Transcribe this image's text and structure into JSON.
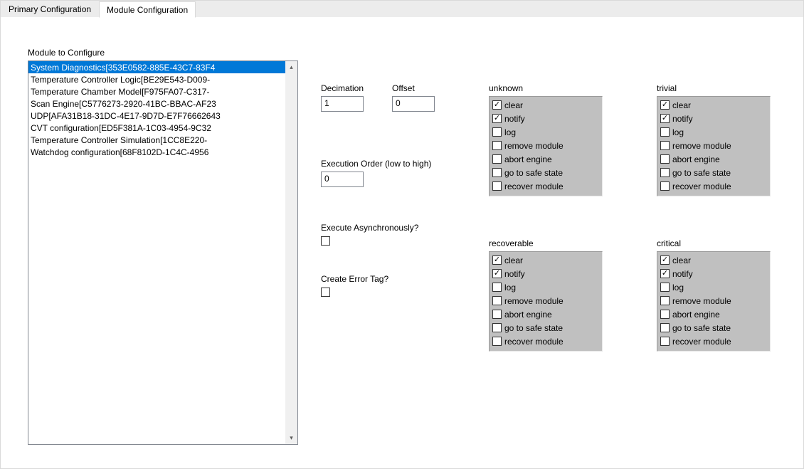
{
  "tabs": {
    "primary": "Primary Configuration",
    "module": "Module Configuration"
  },
  "module_list": {
    "label": "Module to Configure",
    "selected_index": 0,
    "items": [
      "System Diagnostics[353E0582-885E-43C7-83F4",
      "Temperature Controller Logic[BE29E543-D009-",
      "Temperature Chamber Model[F975FA07-C317-",
      "Scan Engine[C5776273-2920-41BC-BBAC-AF23",
      "UDP[AFA31B18-31DC-4E17-9D7D-E7F76662643",
      "CVT configuration[ED5F381A-1C03-4954-9C32",
      "Temperature Controller Simulation[1CC8E220-",
      "Watchdog configuration[68F8102D-1C4C-4956"
    ]
  },
  "fields": {
    "decimation_label": "Decimation",
    "decimation_value": "1",
    "offset_label": "Offset",
    "offset_value": "0",
    "exec_order_label": "Execution Order (low to high)",
    "exec_order_value": "0",
    "async_label": "Execute Asynchronously?",
    "async_checked": false,
    "errtag_label": "Create Error Tag?",
    "errtag_checked": false
  },
  "option_labels": [
    "clear",
    "notify",
    "log",
    "remove module",
    "abort engine",
    "go to safe state",
    "recover module"
  ],
  "groups": {
    "unknown": {
      "title": "unknown",
      "checked": [
        true,
        true,
        false,
        false,
        false,
        false,
        false
      ]
    },
    "trivial": {
      "title": "trivial",
      "checked": [
        true,
        true,
        false,
        false,
        false,
        false,
        false
      ]
    },
    "recoverable": {
      "title": "recoverable",
      "checked": [
        true,
        true,
        false,
        false,
        false,
        false,
        false
      ]
    },
    "critical": {
      "title": "critical",
      "checked": [
        true,
        true,
        false,
        false,
        false,
        false,
        false
      ]
    }
  }
}
